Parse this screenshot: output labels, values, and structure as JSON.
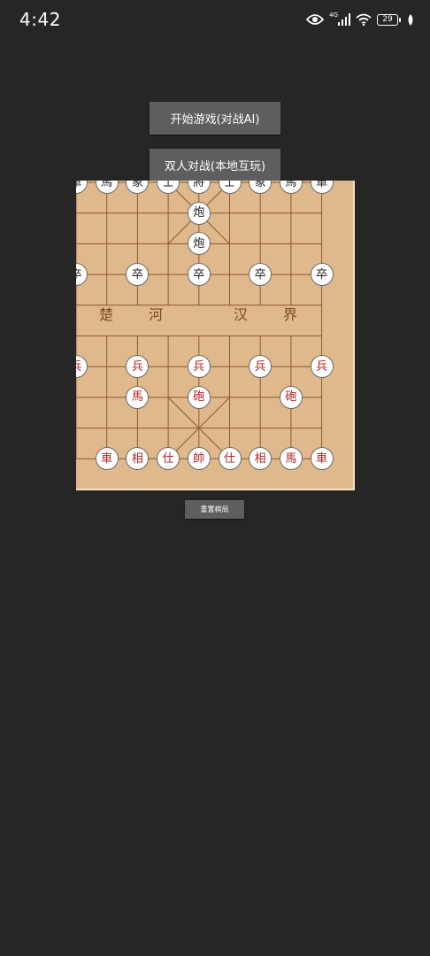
{
  "status_bar": {
    "time": "4:42",
    "network": "4G",
    "battery": "29",
    "icons": [
      "eye-icon",
      "signal-icon",
      "wifi-icon",
      "battery-icon",
      "leaf-icon"
    ]
  },
  "buttons": {
    "start_ai": "开始游戏(对战AI)",
    "pvp_local": "双人对战(本地互玩)",
    "reset": "重置棋局"
  },
  "river": {
    "left_1": "楚",
    "left_2": "河",
    "right_1": "汉",
    "right_2": "界"
  },
  "colors": {
    "background": "#262626",
    "board": "#dfb98b",
    "line": "#8b5a2b",
    "black_piece_text": "#222222",
    "red_piece_text": "#b82020",
    "button": "#5e5e5e"
  },
  "pieces": [
    {
      "label": "車",
      "side": "black",
      "col": 0,
      "row": 0
    },
    {
      "label": "馬",
      "side": "black",
      "col": 1,
      "row": 0
    },
    {
      "label": "象",
      "side": "black",
      "col": 2,
      "row": 0
    },
    {
      "label": "士",
      "side": "black",
      "col": 3,
      "row": 0
    },
    {
      "label": "將",
      "side": "black",
      "col": 4,
      "row": 0
    },
    {
      "label": "士",
      "side": "black",
      "col": 5,
      "row": 0
    },
    {
      "label": "象",
      "side": "black",
      "col": 6,
      "row": 0
    },
    {
      "label": "馬",
      "side": "black",
      "col": 7,
      "row": 0
    },
    {
      "label": "車",
      "side": "black",
      "col": 8,
      "row": 0
    },
    {
      "label": "炮",
      "side": "black",
      "col": 4,
      "row": 1
    },
    {
      "label": "炮",
      "side": "black",
      "col": 4,
      "row": 2
    },
    {
      "label": "卒",
      "side": "black",
      "col": 0,
      "row": 3
    },
    {
      "label": "卒",
      "side": "black",
      "col": 2,
      "row": 3
    },
    {
      "label": "卒",
      "side": "black",
      "col": 4,
      "row": 3
    },
    {
      "label": "卒",
      "side": "black",
      "col": 6,
      "row": 3
    },
    {
      "label": "卒",
      "side": "black",
      "col": 8,
      "row": 3
    },
    {
      "label": "兵",
      "side": "red",
      "col": 0,
      "row": 6
    },
    {
      "label": "兵",
      "side": "red",
      "col": 2,
      "row": 6
    },
    {
      "label": "兵",
      "side": "red",
      "col": 4,
      "row": 6
    },
    {
      "label": "兵",
      "side": "red",
      "col": 6,
      "row": 6
    },
    {
      "label": "兵",
      "side": "red",
      "col": 8,
      "row": 6
    },
    {
      "label": "馬",
      "side": "red",
      "col": 2,
      "row": 7
    },
    {
      "label": "砲",
      "side": "red",
      "col": 4,
      "row": 7
    },
    {
      "label": "砲",
      "side": "red",
      "col": 7,
      "row": 7
    },
    {
      "label": "車",
      "side": "red",
      "col": 1,
      "row": 9
    },
    {
      "label": "相",
      "side": "red",
      "col": 2,
      "row": 9
    },
    {
      "label": "仕",
      "side": "red",
      "col": 3,
      "row": 9
    },
    {
      "label": "帥",
      "side": "red",
      "col": 4,
      "row": 9
    },
    {
      "label": "仕",
      "side": "red",
      "col": 5,
      "row": 9
    },
    {
      "label": "相",
      "side": "red",
      "col": 6,
      "row": 9
    },
    {
      "label": "馬",
      "side": "red",
      "col": 7,
      "row": 9
    },
    {
      "label": "車",
      "side": "red",
      "col": 8,
      "row": 9
    }
  ]
}
